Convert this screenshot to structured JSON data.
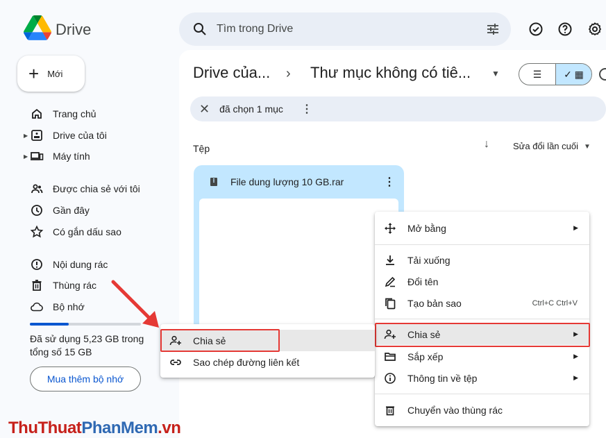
{
  "app": {
    "name": "Drive"
  },
  "search": {
    "placeholder": "Tìm trong Drive",
    "icon": "search-icon",
    "filter_icon": "tune-icon"
  },
  "topbar_icons": [
    "offline-status-icon",
    "help-icon",
    "settings-icon"
  ],
  "new_button": {
    "label": "Mới"
  },
  "sidebar": {
    "items": [
      {
        "label": "Trang chủ",
        "icon": "home-icon"
      },
      {
        "label": "Drive của tôi",
        "icon": "my-drive-icon"
      },
      {
        "label": "Máy tính",
        "icon": "computer-icon"
      },
      {
        "label": "Được chia sẻ với tôi",
        "icon": "shared-icon"
      },
      {
        "label": "Gần đây",
        "icon": "clock-icon"
      },
      {
        "label": "Có gắn dấu sao",
        "icon": "star-icon"
      },
      {
        "label": "Nội dung rác",
        "icon": "spam-icon"
      },
      {
        "label": "Thùng rác",
        "icon": "trash-icon"
      },
      {
        "label": "Bộ nhớ",
        "icon": "cloud-icon"
      }
    ]
  },
  "storage": {
    "text": "Đã sử dụng 5,23 GB trong tổng số 15 GB",
    "used_gb": 5.23,
    "total_gb": 15,
    "buy_label": "Mua thêm bộ nhớ"
  },
  "breadcrumb": {
    "root": "Drive của...",
    "separator": "›",
    "current": "Thư mục không có tiê..."
  },
  "view": {
    "list_icon": "☰",
    "grid_icon": "✓ ▦",
    "active": "grid"
  },
  "selection": {
    "text": "đã chọn 1 mục"
  },
  "files": {
    "section_label": "Tệp",
    "sort_label": "Sửa đổi lần cuối"
  },
  "file_card": {
    "name": "File dung lượng 10 GB.rar",
    "icon": "archive-icon"
  },
  "context_menu": {
    "items": [
      {
        "label": "Mở bằng",
        "icon": "open-with-icon",
        "submenu": true
      },
      {
        "label": "Tải xuống",
        "icon": "download-icon"
      },
      {
        "label": "Đổi tên",
        "icon": "rename-icon"
      },
      {
        "label": "Tạo bản sao",
        "icon": "copy-icon",
        "shortcut": "Ctrl+C Ctrl+V"
      },
      {
        "label": "Chia sẻ",
        "icon": "share-icon",
        "submenu": true,
        "highlighted": true
      },
      {
        "label": "Sắp xếp",
        "icon": "folder-icon",
        "submenu": true
      },
      {
        "label": "Thông tin về tệp",
        "icon": "info-icon",
        "submenu": true
      },
      {
        "label": "Chuyển vào thùng rác",
        "icon": "trash-icon"
      }
    ]
  },
  "share_submenu": {
    "items": [
      {
        "label": "Chia sẻ",
        "icon": "share-icon",
        "highlighted": true
      },
      {
        "label": "Sao chép đường liên kết",
        "icon": "link-icon"
      }
    ]
  },
  "annotation": {
    "highlight_color": "#e53935"
  },
  "watermark": {
    "part1": "ThuThuat",
    "part2": "PhanMem",
    "part3": ".vn"
  },
  "colors": {
    "accent": "#0b57d0",
    "selected": "#c2e7ff",
    "background": "#f8fafd",
    "arrow": "#e53935"
  }
}
